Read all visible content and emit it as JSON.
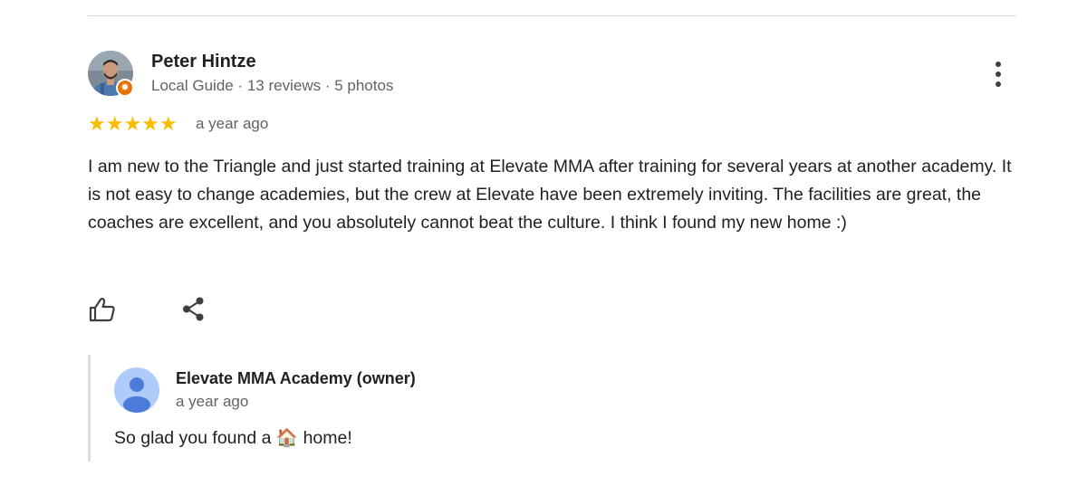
{
  "reviewer": {
    "name": "Peter Hintze",
    "meta": "Local Guide · 13 reviews · 5 photos",
    "avatar_icon": "reviewer-photo",
    "badge_icon": "local-guide-badge-icon"
  },
  "rating": {
    "stars": "★★★★★",
    "value": 5,
    "max": 5,
    "date": "a year ago",
    "color": "#fbbc04"
  },
  "review": {
    "text": "I am new to the Triangle and just started training at Elevate MMA after training for several years at another academy. It is not easy to change academies, but the crew at Elevate have been extremely inviting. The facilities are great, the coaches are excellent, and you absolutely cannot beat the culture. I think I found my new home :)"
  },
  "actions": {
    "like_icon": "thumbs-up-icon",
    "share_icon": "share-icon",
    "more_icon": "more-vert-icon"
  },
  "owner_response": {
    "name": "Elevate MMA Academy (owner)",
    "date": "a year ago",
    "text": "So glad you found a 🏠 home!",
    "avatar_icon": "default-person-icon",
    "avatar_color": "#aecbfa"
  },
  "colors": {
    "badge": "#e8710a",
    "secondary_text": "#5f6368",
    "divider": "#dadce0"
  }
}
